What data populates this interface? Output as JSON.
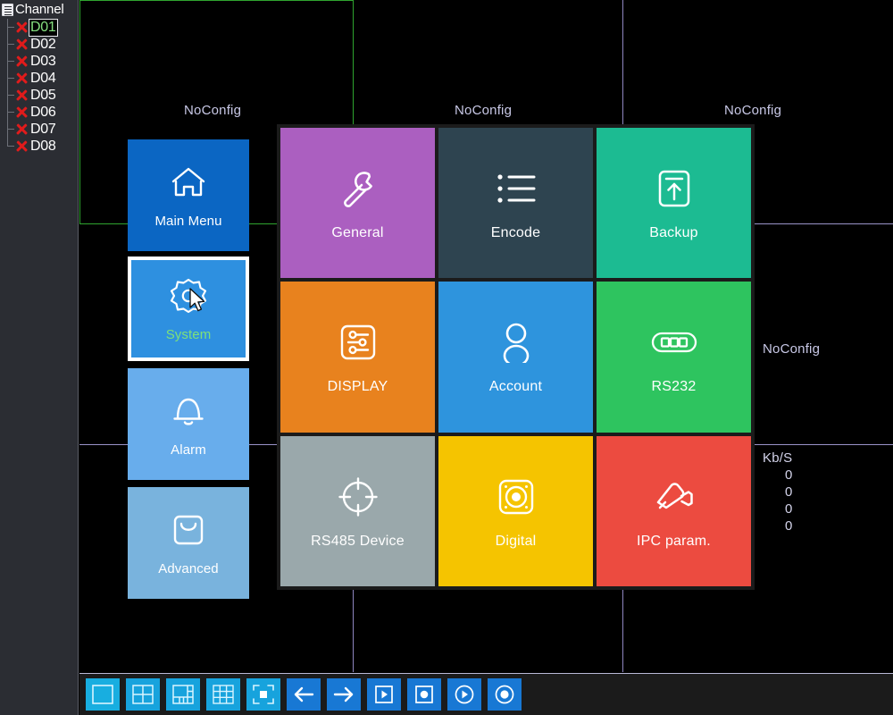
{
  "sidebar": {
    "title": "Channel",
    "title_icon": "list-document-icon",
    "channels": [
      {
        "id": "D01",
        "status_icon": "red-x-icon",
        "selected": true
      },
      {
        "id": "D02",
        "status_icon": "red-x-icon",
        "selected": false
      },
      {
        "id": "D03",
        "status_icon": "red-x-icon",
        "selected": false
      },
      {
        "id": "D04",
        "status_icon": "red-x-icon",
        "selected": false
      },
      {
        "id": "D05",
        "status_icon": "red-x-icon",
        "selected": false
      },
      {
        "id": "D06",
        "status_icon": "red-x-icon",
        "selected": false
      },
      {
        "id": "D07",
        "status_icon": "red-x-icon",
        "selected": false
      },
      {
        "id": "D08",
        "status_icon": "red-x-icon",
        "selected": false
      }
    ]
  },
  "video_wall": {
    "pane_labels": [
      "NoConfig",
      "NoConfig",
      "NoConfig",
      "NoConfig"
    ],
    "selected_pane_border_color": "#2fa52f",
    "pane_border_color": "#9a93c8",
    "stats": {
      "label": "Kb/S",
      "values": [
        "0",
        "0",
        "0",
        "0"
      ]
    }
  },
  "left_menu": {
    "items": [
      {
        "label": "Main Menu",
        "icon": "home-icon",
        "color": "#0b66c3",
        "selected": false
      },
      {
        "label": "System",
        "icon": "gear-icon",
        "color": "#2e90e0",
        "selected": true
      },
      {
        "label": "Alarm",
        "icon": "bell-icon",
        "color": "#68adec",
        "selected": false
      },
      {
        "label": "Advanced",
        "icon": "tools-icon",
        "color": "#79b3dd",
        "selected": false
      }
    ]
  },
  "tiles": [
    {
      "label": "General",
      "icon": "wrench-icon",
      "color": "#ab5fc0"
    },
    {
      "label": "Encode",
      "icon": "list-icon",
      "color": "#2e4450"
    },
    {
      "label": "Backup",
      "icon": "upload-box-icon",
      "color": "#1cbb92"
    },
    {
      "label": "DISPLAY",
      "icon": "sliders-icon",
      "color": "#e8821e"
    },
    {
      "label": "Account",
      "icon": "user-icon",
      "color": "#2e94dd"
    },
    {
      "label": "RS232",
      "icon": "serial-port-icon",
      "color": "#2ec45f"
    },
    {
      "label": "RS485 Device",
      "icon": "crosshair-icon",
      "color": "#9aa8ab"
    },
    {
      "label": "Digital",
      "icon": "dome-camera-icon",
      "color": "#f5c400"
    },
    {
      "label": "IPC param.",
      "icon": "bullet-camera-icon",
      "color": "#ec4b40"
    }
  ],
  "toolbar": {
    "buttons": [
      {
        "name": "single-view-button",
        "icon": "layout-1-icon",
        "style": "cyan-active"
      },
      {
        "name": "quad-view-button",
        "icon": "layout-4-icon",
        "style": "cyan"
      },
      {
        "name": "six-view-button",
        "icon": "layout-6-icon",
        "style": "cyan"
      },
      {
        "name": "nine-view-button",
        "icon": "layout-9-icon",
        "style": "cyan"
      },
      {
        "name": "fullscreen-button",
        "icon": "fullscreen-icon",
        "style": "cyan"
      },
      {
        "name": "previous-button",
        "icon": "arrow-left-icon",
        "style": "blue"
      },
      {
        "name": "next-button",
        "icon": "arrow-right-icon",
        "style": "blue"
      },
      {
        "name": "playback-button",
        "icon": "play-square-icon",
        "style": "blue"
      },
      {
        "name": "record-button",
        "icon": "record-square-icon",
        "style": "blue"
      },
      {
        "name": "play-circle-button",
        "icon": "play-circle-icon",
        "style": "blue"
      },
      {
        "name": "record-circle-button",
        "icon": "record-circle-icon",
        "style": "blue"
      }
    ]
  },
  "cursor": {
    "visible": true,
    "over": "System"
  }
}
